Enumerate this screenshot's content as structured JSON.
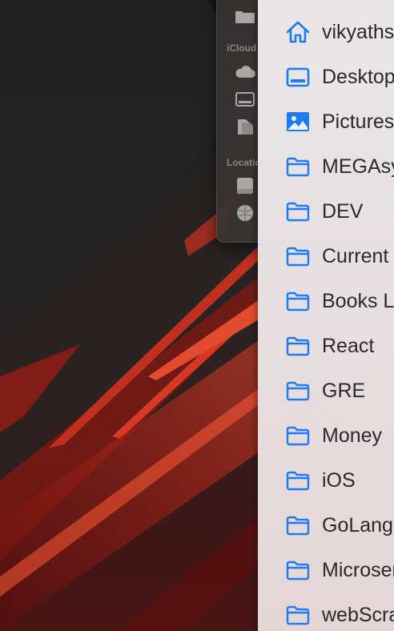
{
  "back_window": {
    "sections": [
      {
        "label": "iCloud"
      },
      {
        "label": "Locations"
      }
    ]
  },
  "menu": {
    "accent_color": "#1f7bf2",
    "items": [
      {
        "label": "vikyathsharma",
        "icon": "home-icon"
      },
      {
        "label": "Desktop",
        "icon": "desktop-icon"
      },
      {
        "label": "Pictures",
        "icon": "pictures-icon"
      },
      {
        "label": "MEGAsync",
        "icon": "folder-icon"
      },
      {
        "label": "DEV",
        "icon": "folder-icon"
      },
      {
        "label": "Current",
        "icon": "folder-icon"
      },
      {
        "label": "Books Library",
        "icon": "folder-icon"
      },
      {
        "label": "React",
        "icon": "folder-icon"
      },
      {
        "label": "GRE",
        "icon": "folder-icon"
      },
      {
        "label": "Money",
        "icon": "folder-icon"
      },
      {
        "label": "iOS",
        "icon": "folder-icon"
      },
      {
        "label": "GoLang",
        "icon": "folder-icon"
      },
      {
        "label": "Microservices",
        "icon": "folder-icon"
      },
      {
        "label": "webScraping",
        "icon": "folder-icon"
      }
    ]
  }
}
